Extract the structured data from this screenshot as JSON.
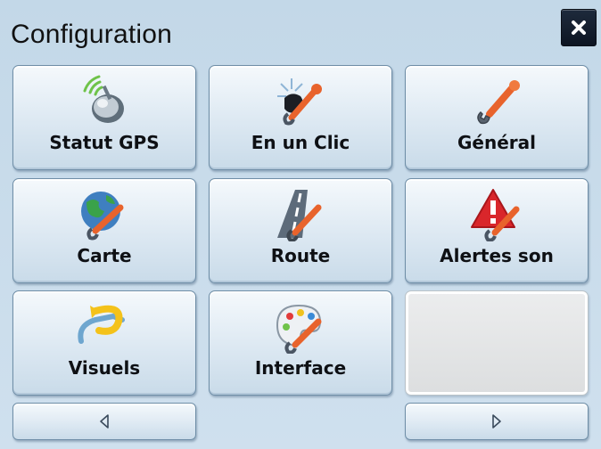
{
  "header": {
    "title": "Configuration",
    "close_icon": "close-icon"
  },
  "tiles": [
    {
      "label": "Statut GPS",
      "icon": "gps-satellite-icon"
    },
    {
      "label": "En un Clic",
      "icon": "one-click-icon"
    },
    {
      "label": "Général",
      "icon": "wrench-icon"
    },
    {
      "label": "Carte",
      "icon": "globe-wrench-icon"
    },
    {
      "label": "Route",
      "icon": "road-wrench-icon"
    },
    {
      "label": "Alertes son",
      "icon": "warning-wrench-icon"
    },
    {
      "label": "Visuels",
      "icon": "visuals-arrow-icon"
    },
    {
      "label": "Interface",
      "icon": "palette-wrench-icon"
    }
  ],
  "nav": {
    "prev_icon": "triangle-left-icon",
    "next_icon": "triangle-right-icon"
  },
  "colors": {
    "background": "#c9dcea",
    "tile_border": "#6f8ea7",
    "close_button": "#121c2b",
    "accent_orange": "#e8632c",
    "accent_green": "#6fc34a",
    "alert_red": "#d9262b"
  }
}
